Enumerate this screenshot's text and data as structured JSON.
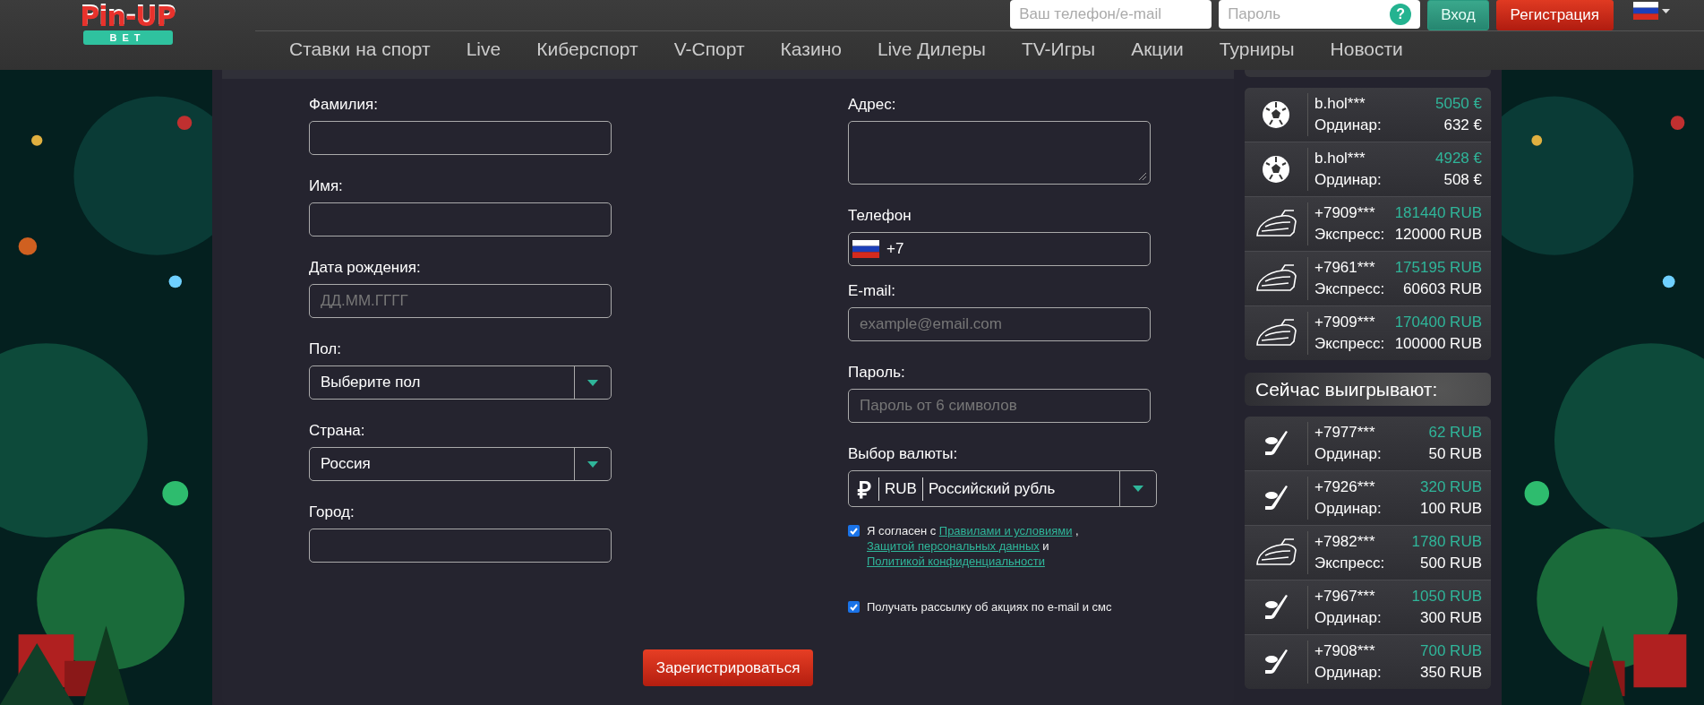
{
  "header": {
    "logo": {
      "top": "Pin-UP",
      "bottom": "BET"
    },
    "login": {
      "phone_placeholder": "Ваш телефон/e-mail",
      "password_placeholder": "Пароль",
      "help": "?",
      "login_button": "Вход",
      "register_button": "Регистрация"
    },
    "nav": [
      {
        "label": "Ставки на спорт"
      },
      {
        "label": "Live"
      },
      {
        "label": "Киберспорт"
      },
      {
        "label": "V-Спорт"
      },
      {
        "label": "Казино"
      },
      {
        "label": "Live Дилеры"
      },
      {
        "label": "TV-Игры"
      },
      {
        "label": "Акции"
      },
      {
        "label": "Турниры"
      },
      {
        "label": "Новости"
      }
    ]
  },
  "form": {
    "left_fields": [
      {
        "kind": "text",
        "label": "Фамилия:"
      },
      {
        "kind": "text",
        "label": "Имя:"
      },
      {
        "kind": "text",
        "label": "Дата рождения:",
        "placeholder": "ДД.ММ.ГГГГ"
      },
      {
        "kind": "select",
        "label": "Пол:",
        "value": "Выберите пол"
      },
      {
        "kind": "select",
        "label": "Страна:",
        "value": "Россия"
      },
      {
        "kind": "text",
        "label": "Город:"
      }
    ],
    "right_fields": [
      {
        "kind": "textarea",
        "label": "Адрес:"
      },
      {
        "kind": "phone",
        "label": "Телефон",
        "value": "+7"
      },
      {
        "kind": "text",
        "label": "E-mail:",
        "placeholder": "example@email.com"
      },
      {
        "kind": "text",
        "label": "Пароль:",
        "placeholder": "Пароль от 6 символов"
      },
      {
        "kind": "currency",
        "label": "Выбор валюты:",
        "symbol": "₽",
        "code": "RUB",
        "value": "Российский рубль"
      }
    ],
    "consents": [
      {
        "checked": true,
        "parts": [
          {
            "kind": "text",
            "text": "Я согласен с "
          },
          {
            "kind": "link",
            "text": "Правилами и условиями"
          },
          {
            "kind": "text",
            "text": " , "
          },
          {
            "kind": "link",
            "text": "Защитой персональных данных"
          },
          {
            "kind": "text",
            "text": " и "
          },
          {
            "kind": "link",
            "text": "Политикой конфиденциальности"
          }
        ]
      },
      {
        "checked": true,
        "parts": [
          {
            "kind": "text",
            "text": "Получать рассылку об акциях по e-mail и смс"
          }
        ]
      }
    ],
    "submit": "Зарегистрироваться"
  },
  "winners_top": [
    {
      "kind": "football",
      "user": "b.hol***",
      "win": "5050 €",
      "bet_type": "Ординар:",
      "stake": "632 €"
    },
    {
      "kind": "football",
      "user": "b.hol***",
      "win": "4928 €",
      "bet_type": "Ординар:",
      "stake": "508 €"
    },
    {
      "kind": "express",
      "user": "+7909***",
      "win": "181440 RUB",
      "bet_type": "Экспресс:",
      "stake": "120000 RUB"
    },
    {
      "kind": "express",
      "user": "+7961***",
      "win": "175195 RUB",
      "bet_type": "Экспресс:",
      "stake": "60603 RUB"
    },
    {
      "kind": "express",
      "user": "+7909***",
      "win": "170400 RUB",
      "bet_type": "Экспресс:",
      "stake": "100000 RUB"
    }
  ],
  "winning_now": {
    "title": "Сейчас выигрывают:",
    "items": [
      {
        "kind": "hockey",
        "user": "+7977***",
        "win": "62 RUB",
        "bet_type": "Ординар:",
        "stake": "50 RUB"
      },
      {
        "kind": "hockey",
        "user": "+7926***",
        "win": "320 RUB",
        "bet_type": "Ординар:",
        "stake": "100 RUB"
      },
      {
        "kind": "express",
        "user": "+7982***",
        "win": "1780 RUB",
        "bet_type": "Экспресс:",
        "stake": "500 RUB"
      },
      {
        "kind": "hockey",
        "user": "+7967***",
        "win": "1050 RUB",
        "bet_type": "Ординар:",
        "stake": "300 RUB"
      },
      {
        "kind": "hockey",
        "user": "+7908***",
        "win": "700 RUB",
        "bet_type": "Ординар:",
        "stake": "350 RUB"
      }
    ]
  }
}
